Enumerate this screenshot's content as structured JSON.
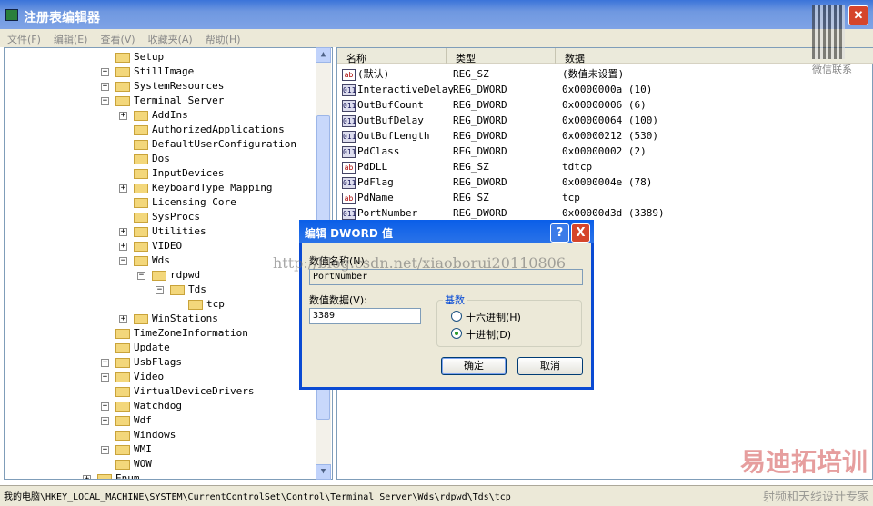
{
  "window": {
    "title": "注册表编辑器"
  },
  "menu": [
    "文件(F)",
    "编辑(E)",
    "查看(V)",
    "收藏夹(A)",
    "帮助(H)"
  ],
  "tree": [
    {
      "label": "Setup",
      "level": 1,
      "exp": ""
    },
    {
      "label": "StillImage",
      "level": 1,
      "exp": "+"
    },
    {
      "label": "SystemResources",
      "level": 1,
      "exp": "+"
    },
    {
      "label": "Terminal Server",
      "level": 1,
      "exp": "-"
    },
    {
      "label": "AddIns",
      "level": 2,
      "exp": "+"
    },
    {
      "label": "AuthorizedApplications",
      "level": 2,
      "exp": ""
    },
    {
      "label": "DefaultUserConfiguration",
      "level": 2,
      "exp": ""
    },
    {
      "label": "Dos",
      "level": 2,
      "exp": ""
    },
    {
      "label": "InputDevices",
      "level": 2,
      "exp": ""
    },
    {
      "label": "KeyboardType Mapping",
      "level": 2,
      "exp": "+"
    },
    {
      "label": "Licensing Core",
      "level": 2,
      "exp": ""
    },
    {
      "label": "SysProcs",
      "level": 2,
      "exp": ""
    },
    {
      "label": "Utilities",
      "level": 2,
      "exp": "+"
    },
    {
      "label": "VIDEO",
      "level": 2,
      "exp": "+"
    },
    {
      "label": "Wds",
      "level": 2,
      "exp": "-"
    },
    {
      "label": "rdpwd",
      "level": 3,
      "exp": "-"
    },
    {
      "label": "Tds",
      "level": 4,
      "exp": "-"
    },
    {
      "label": "tcp",
      "level": 5,
      "exp": ""
    },
    {
      "label": "WinStations",
      "level": 2,
      "exp": "+"
    },
    {
      "label": "TimeZoneInformation",
      "level": 1,
      "exp": ""
    },
    {
      "label": "Update",
      "level": 1,
      "exp": ""
    },
    {
      "label": "UsbFlags",
      "level": 1,
      "exp": "+"
    },
    {
      "label": "Video",
      "level": 1,
      "exp": "+"
    },
    {
      "label": "VirtualDeviceDrivers",
      "level": 1,
      "exp": ""
    },
    {
      "label": "Watchdog",
      "level": 1,
      "exp": "+"
    },
    {
      "label": "Wdf",
      "level": 1,
      "exp": "+"
    },
    {
      "label": "Windows",
      "level": 1,
      "exp": ""
    },
    {
      "label": "WMI",
      "level": 1,
      "exp": "+"
    },
    {
      "label": "WOW",
      "level": 1,
      "exp": ""
    },
    {
      "label": "Enum",
      "level": 0,
      "exp": "+"
    }
  ],
  "columns": [
    "名称",
    "类型",
    "数据"
  ],
  "values": [
    {
      "name": "(默认)",
      "type": "REG_SZ",
      "data": "(数值未设置)",
      "icon": "ab"
    },
    {
      "name": "InteractiveDelay",
      "type": "REG_DWORD",
      "data": "0x0000000a (10)",
      "icon": "bin"
    },
    {
      "name": "OutBufCount",
      "type": "REG_DWORD",
      "data": "0x00000006 (6)",
      "icon": "bin"
    },
    {
      "name": "OutBufDelay",
      "type": "REG_DWORD",
      "data": "0x00000064 (100)",
      "icon": "bin"
    },
    {
      "name": "OutBufLength",
      "type": "REG_DWORD",
      "data": "0x00000212 (530)",
      "icon": "bin"
    },
    {
      "name": "PdClass",
      "type": "REG_DWORD",
      "data": "0x00000002 (2)",
      "icon": "bin"
    },
    {
      "name": "PdDLL",
      "type": "REG_SZ",
      "data": "tdtcp",
      "icon": "ab"
    },
    {
      "name": "PdFlag",
      "type": "REG_DWORD",
      "data": "0x0000004e (78)",
      "icon": "bin"
    },
    {
      "name": "PdName",
      "type": "REG_SZ",
      "data": "tcp",
      "icon": "ab"
    },
    {
      "name": "PortNumber",
      "type": "REG_DWORD",
      "data": "0x00000d3d (3389)",
      "icon": "bin"
    }
  ],
  "dialog": {
    "title": "编辑 DWORD 值",
    "help": "?",
    "close": "X",
    "name_label": "数值名称(N):",
    "name_value": "PortNumber",
    "data_label": "数值数据(V):",
    "data_value": "3389",
    "base_label": "基数",
    "hex_label": "十六进制(H)",
    "dec_label": "十进制(D)",
    "selected": "dec",
    "ok": "确定",
    "cancel": "取消"
  },
  "status": "我的电脑\\HKEY_LOCAL_MACHINE\\SYSTEM\\CurrentControlSet\\Control\\Terminal Server\\Wds\\rdpwd\\Tds\\tcp",
  "watermark": "http://blog.csdn.net/xiaoborui20110806",
  "brand": {
    "logo": "易迪拓培训",
    "tagline": "射频和天线设计专家",
    "qr_caption": "微信联系"
  }
}
